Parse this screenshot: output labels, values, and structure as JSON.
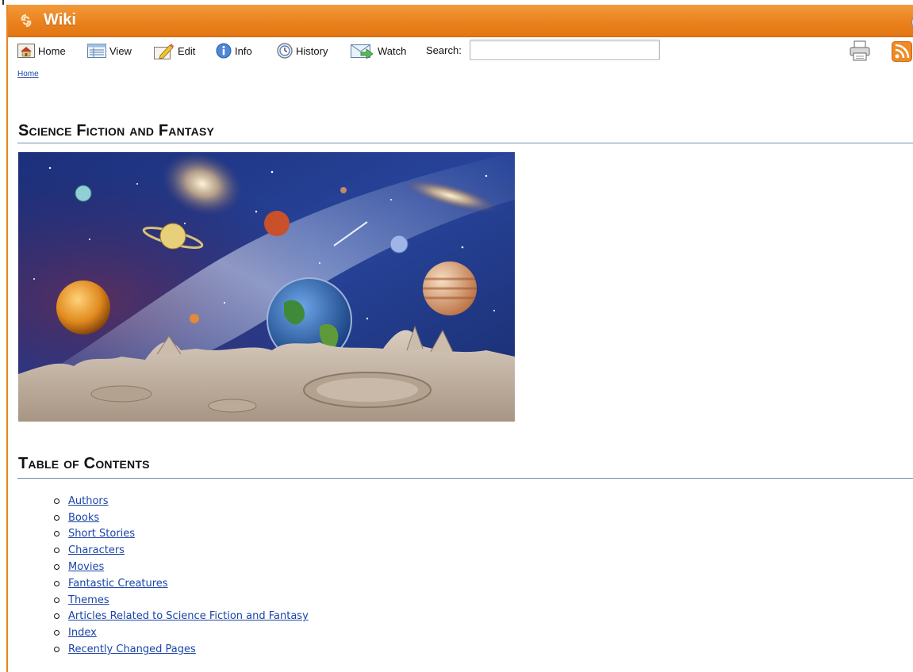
{
  "app": {
    "title": "Wiki"
  },
  "toolbar": {
    "items": [
      {
        "label": "Home",
        "icon": "home-icon"
      },
      {
        "label": "View",
        "icon": "view-icon"
      },
      {
        "label": "Edit",
        "icon": "edit-icon"
      },
      {
        "label": "Info",
        "icon": "info-icon"
      },
      {
        "label": "History",
        "icon": "history-icon"
      },
      {
        "label": "Watch",
        "icon": "watch-icon"
      }
    ],
    "search_label": "Search:",
    "search_value": "",
    "print_icon": "printer-icon",
    "rss_icon": "rss-icon"
  },
  "breadcrumb": {
    "items": [
      "Home"
    ]
  },
  "page": {
    "title": "Science Fiction and Fantasy",
    "toc_heading": "Table of Contents",
    "toc": [
      "Authors",
      "Books",
      "Short Stories",
      "Characters",
      "Movies",
      "Fantastic Creatures",
      "Themes",
      "Articles Related to Science Fiction and Fantasy",
      "Index",
      "Recently Changed Pages"
    ]
  },
  "colors": {
    "header_orange": "#e9801c",
    "link_blue": "#1a45a8",
    "rule_blue": "#6f8fb0"
  }
}
